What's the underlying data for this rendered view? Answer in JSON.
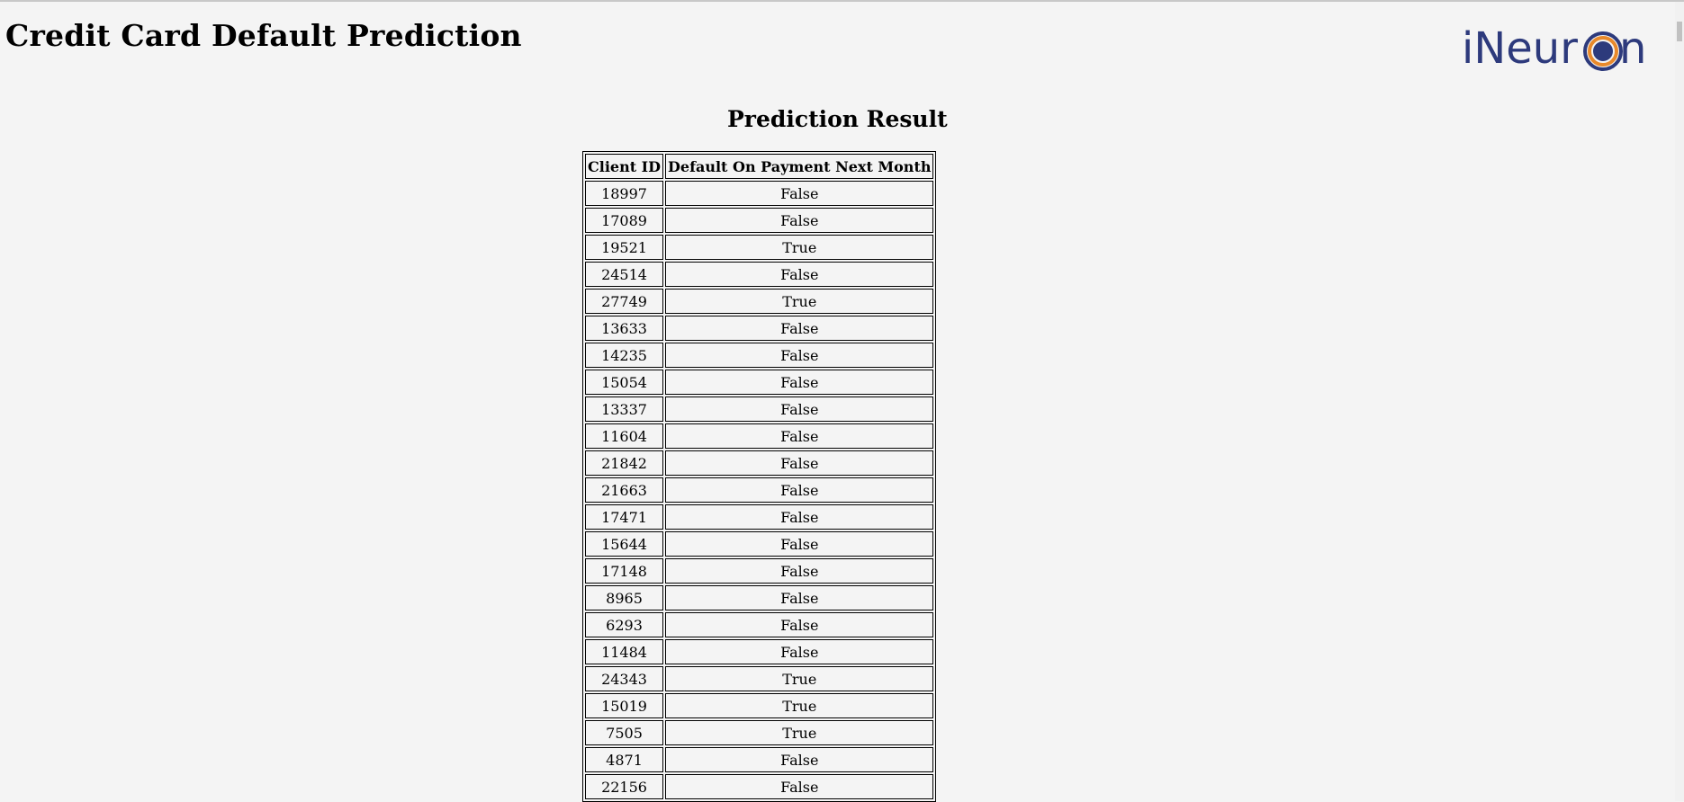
{
  "header": {
    "title": "Credit Card Default Prediction",
    "logo_text": "iNeur",
    "logo_tail": "n"
  },
  "main": {
    "heading": "Prediction Result",
    "columns": [
      "Client ID",
      "Default On Payment Next Month"
    ],
    "rows": [
      [
        "18997",
        "False"
      ],
      [
        "17089",
        "False"
      ],
      [
        "19521",
        "True"
      ],
      [
        "24514",
        "False"
      ],
      [
        "27749",
        "True"
      ],
      [
        "13633",
        "False"
      ],
      [
        "14235",
        "False"
      ],
      [
        "15054",
        "False"
      ],
      [
        "13337",
        "False"
      ],
      [
        "11604",
        "False"
      ],
      [
        "21842",
        "False"
      ],
      [
        "21663",
        "False"
      ],
      [
        "17471",
        "False"
      ],
      [
        "15644",
        "False"
      ],
      [
        "17148",
        "False"
      ],
      [
        "8965",
        "False"
      ],
      [
        "6293",
        "False"
      ],
      [
        "11484",
        "False"
      ],
      [
        "24343",
        "True"
      ],
      [
        "15019",
        "True"
      ],
      [
        "7505",
        "True"
      ],
      [
        "4871",
        "False"
      ],
      [
        "22156",
        "False"
      ]
    ]
  },
  "colors": {
    "background": "#f4f4f4",
    "logo_blue": "#2d3a7c",
    "logo_orange": "#e8892b"
  }
}
